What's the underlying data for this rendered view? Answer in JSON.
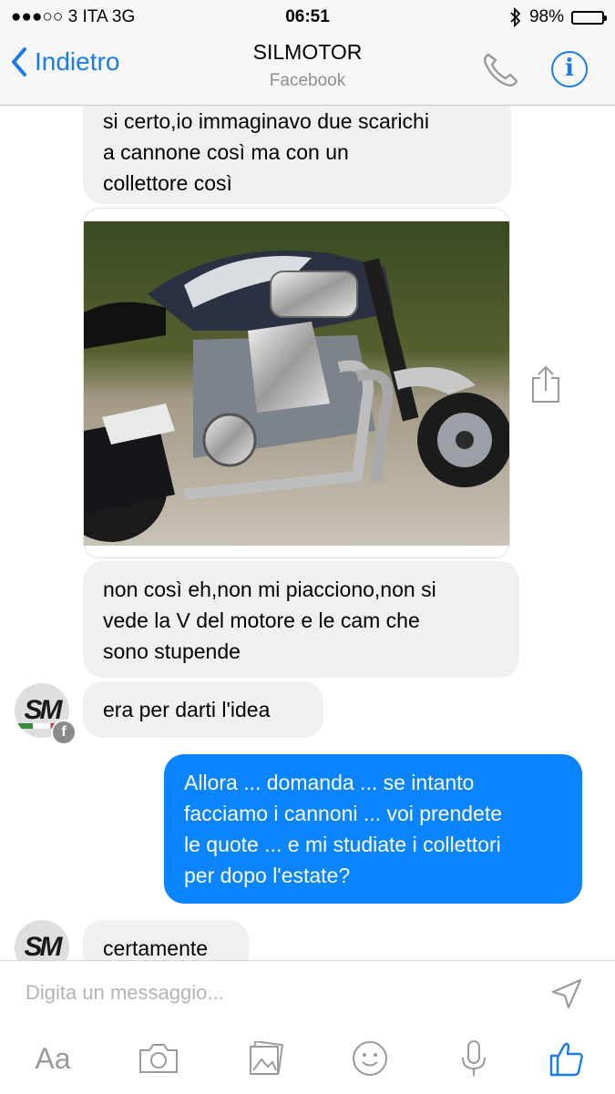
{
  "status_bar": {
    "carrier": "●●●○○ 3 ITA   3G",
    "time": "06:51",
    "battery": "98%",
    "battery_level": 0.98,
    "bluetooth_icon": "bluetooth-icon"
  },
  "nav": {
    "back_label": "Indietro",
    "title": "SILMOTOR",
    "subtitle": "Facebook",
    "info_glyph": "i"
  },
  "messages": [
    {
      "direction": "incoming",
      "text": "si certo,io immaginavo due scarichi\na cannone così ma con un\ncollettore così"
    },
    {
      "direction": "incoming",
      "type": "photo",
      "icon": "motorcycle-photo"
    },
    {
      "direction": "incoming",
      "text": "non così eh,non mi piacciono,non si\nvede la V del motore e le cam che\nsono stupende"
    },
    {
      "direction": "incoming",
      "text": "era per darti l'idea"
    },
    {
      "direction": "outgoing",
      "text": "Allora ... domanda ... se intanto\nfacciamo i cannoni ... voi prendete\nle quote ... e mi studiate i collettori\nper dopo l'estate?"
    },
    {
      "direction": "incoming",
      "text": "certamente"
    }
  ],
  "avatar": {
    "initials": "SM"
  },
  "composer": {
    "placeholder": "Digita un messaggio...",
    "aa_label": "Aa"
  },
  "colors": {
    "accent": "#1b7bea",
    "outgoing_bubble": "#0a84ff",
    "incoming_bubble": "#f0f0f0"
  }
}
